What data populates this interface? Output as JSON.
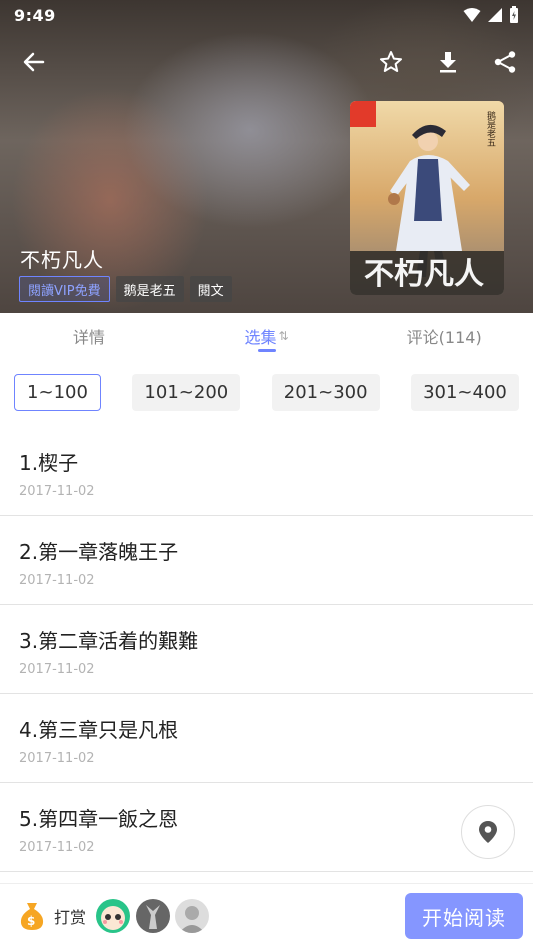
{
  "status": {
    "time": "9:49"
  },
  "book": {
    "title": "不朽凡人",
    "tags": [
      "閱讀VIP免費",
      "鹅是老五",
      "閱文"
    ],
    "cover_text": "不朽凡人",
    "cover_author_vertical": "鹅是老五"
  },
  "tabs": [
    {
      "label": "详情"
    },
    {
      "label": "选集",
      "sort_icon": "⇅"
    },
    {
      "label": "评论(114)"
    }
  ],
  "ranges": [
    "1~100",
    "101~200",
    "201~300",
    "301~400"
  ],
  "chapters": [
    {
      "title": "1.楔子",
      "date": "2017-11-02"
    },
    {
      "title": "2.第一章落魄王子",
      "date": "2017-11-02"
    },
    {
      "title": "3.第二章活着的艱難",
      "date": "2017-11-02"
    },
    {
      "title": "4.第三章只是凡根",
      "date": "2017-11-02"
    },
    {
      "title": "5.第四章一飯之恩",
      "date": "2017-11-02"
    }
  ],
  "bottom": {
    "tip_label": "打赏",
    "start_label": "开始阅读"
  },
  "icons": {
    "back": "arrow-left-icon",
    "star": "star-outline-icon",
    "download": "download-icon",
    "share": "share-icon",
    "location": "location-pin-icon",
    "coin_bag": "money-bag-icon"
  },
  "colors": {
    "accent": "#6f84ff",
    "start_button": "#8596ff"
  }
}
